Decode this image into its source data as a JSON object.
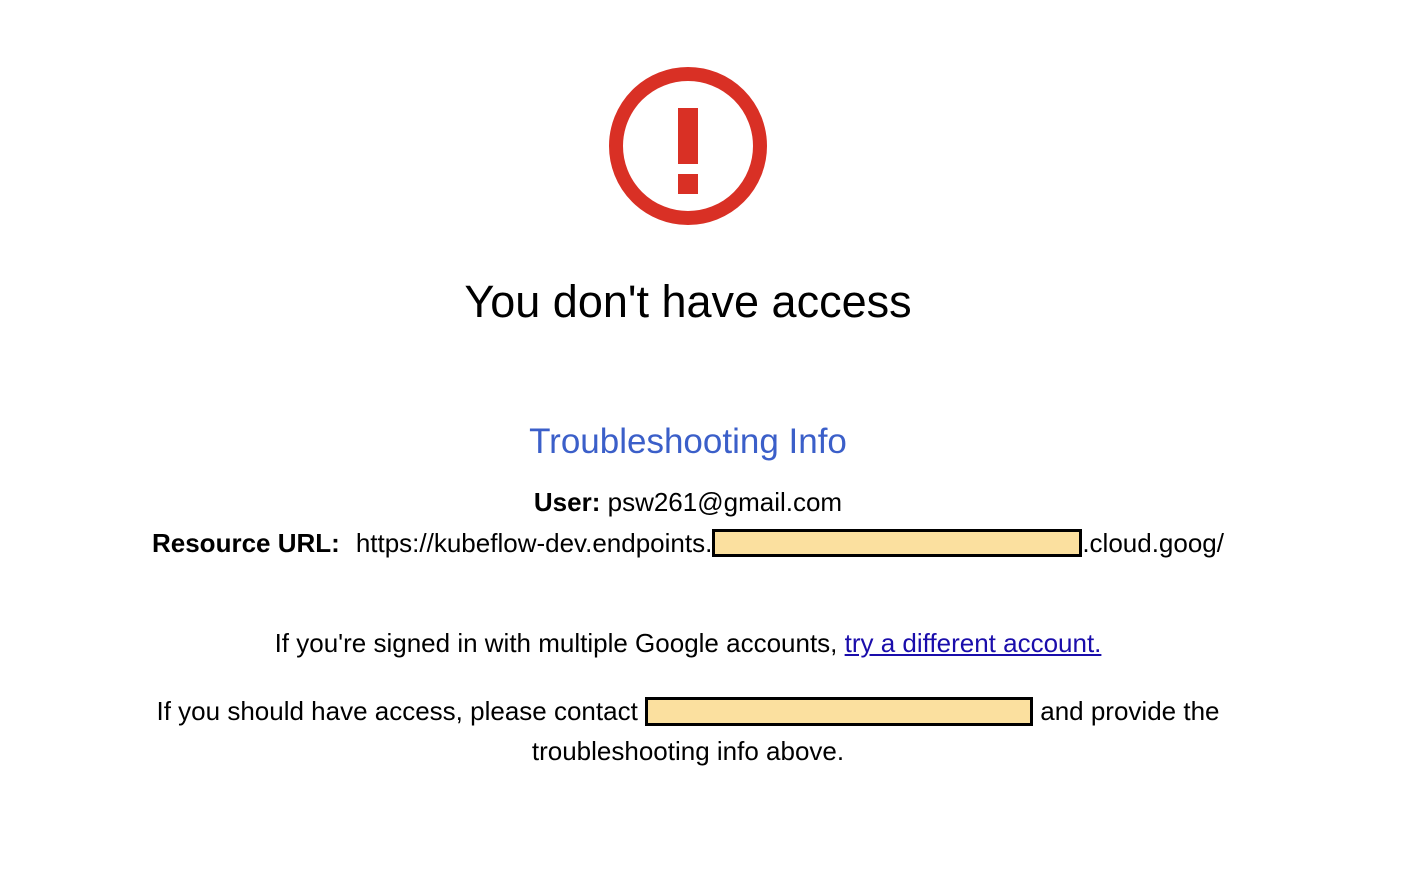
{
  "page": {
    "title": "You don't have access",
    "icon": "error-circle-exclamation-icon",
    "icon_color": "#d93025"
  },
  "troubleshooting": {
    "heading": "Troubleshooting Info",
    "heading_color": "#3b5fc9",
    "user_label": "User:",
    "user_value": "psw261@gmail.com",
    "resource_label": "Resource URL:",
    "resource_url_prefix": "https://kubeflow-dev.endpoints.",
    "resource_url_suffix": ".cloud.goog/",
    "redaction_color": "#fbe09f"
  },
  "messages": {
    "signed_in_text": "If you're signed in with multiple Google accounts, ",
    "try_different_link": "try a different account.",
    "contact_prefix": "If you should have access, please contact ",
    "contact_suffix": " and provide the",
    "contact_line2": "troubleshooting info above.",
    "link_color": "#1a0dab"
  }
}
